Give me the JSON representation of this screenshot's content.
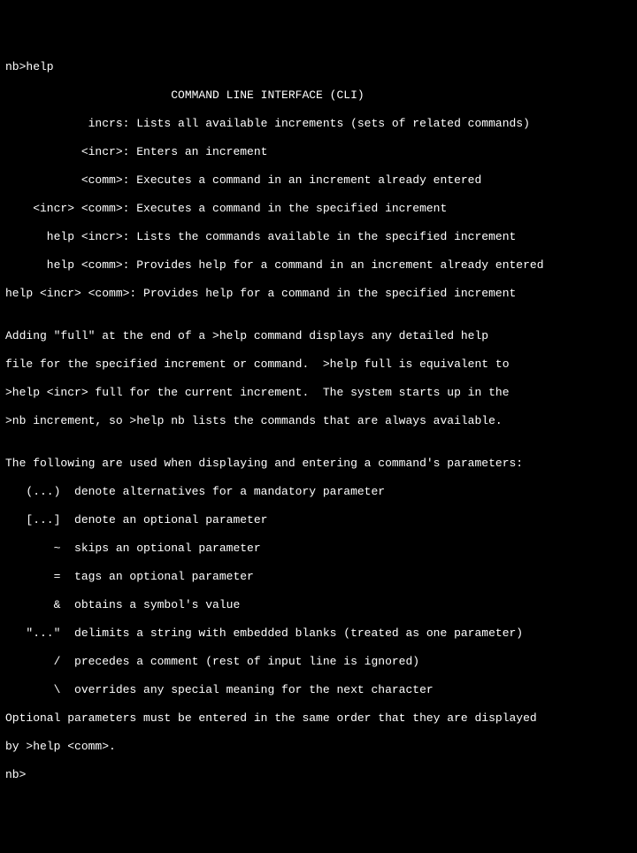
{
  "terminal": {
    "prompt_line": "nb>help",
    "title": "                        COMMAND LINE INTERFACE (CLI)",
    "commands": [
      "            incrs: Lists all available increments (sets of related commands)",
      "           <incr>: Enters an increment",
      "           <comm>: Executes a command in an increment already entered",
      "    <incr> <comm>: Executes a command in the specified increment",
      "      help <incr>: Lists the commands available in the specified increment",
      "      help <comm>: Provides help for a command in an increment already entered",
      "help <incr> <comm>: Provides help for a command in the specified increment"
    ],
    "blank1": "",
    "para1": [
      "Adding \"full\" at the end of a >help command displays any detailed help",
      "file for the specified increment or command.  >help full is equivalent to",
      ">help <incr> full for the current increment.  The system starts up in the",
      ">nb increment, so >help nb lists the commands that are always available."
    ],
    "blank2": "",
    "params_intro": "The following are used when displaying and entering a command's parameters:",
    "params": [
      "   (...)  denote alternatives for a mandatory parameter",
      "   [...]  denote an optional parameter",
      "       ~  skips an optional parameter",
      "       =  tags an optional parameter",
      "       &  obtains a symbol's value",
      "   \"...\"  delimits a string with embedded blanks (treated as one parameter)",
      "       /  precedes a comment (rest of input line is ignored)",
      "       \\  overrides any special meaning for the next character"
    ],
    "footer": [
      "Optional parameters must be entered in the same order that they are displayed",
      "by >help <comm>."
    ],
    "end_prompt": "nb>"
  }
}
